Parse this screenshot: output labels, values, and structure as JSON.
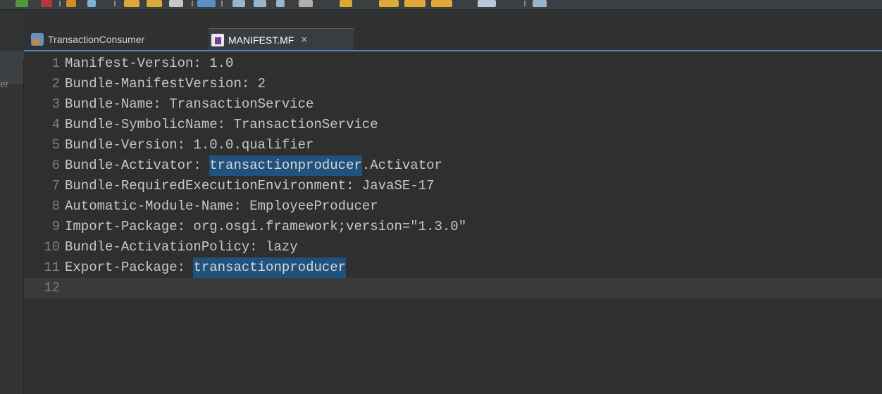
{
  "tabs": [
    {
      "label": "TransactionConsumer",
      "icon": "plugin-project-icon",
      "active": false
    },
    {
      "label": "MANIFEST.MF",
      "icon": "manifest-file-icon",
      "active": true,
      "close": "×"
    }
  ],
  "left_panel": {
    "fragment": "er"
  },
  "editor": {
    "highlight_term": "transactionproducer",
    "lines": [
      {
        "num": "1",
        "pre": "Manifest-Version: 1.0",
        "hl": "",
        "post": ""
      },
      {
        "num": "2",
        "pre": "Bundle-ManifestVersion: 2",
        "hl": "",
        "post": ""
      },
      {
        "num": "3",
        "pre": "Bundle-Name: TransactionService",
        "hl": "",
        "post": ""
      },
      {
        "num": "4",
        "pre": "Bundle-SymbolicName: TransactionService",
        "hl": "",
        "post": ""
      },
      {
        "num": "5",
        "pre": "Bundle-Version: 1.0.0.qualifier",
        "hl": "",
        "post": ""
      },
      {
        "num": "6",
        "pre": "Bundle-Activator: ",
        "hl": "transactionproducer",
        "post": ".Activator"
      },
      {
        "num": "7",
        "pre": "Bundle-RequiredExecutionEnvironment: JavaSE-17",
        "hl": "",
        "post": ""
      },
      {
        "num": "8",
        "pre": "Automatic-Module-Name: EmployeeProducer",
        "hl": "",
        "post": ""
      },
      {
        "num": "9",
        "pre": "Import-Package: org.osgi.framework;version=\"1.3.0\"",
        "hl": "",
        "post": ""
      },
      {
        "num": "10",
        "pre": "Bundle-ActivationPolicy: lazy",
        "hl": "",
        "post": ""
      },
      {
        "num": "11",
        "pre": "Export-Package: ",
        "hl": "transactionproducer",
        "post": ""
      },
      {
        "num": "12",
        "pre": "",
        "hl": "",
        "post": ""
      }
    ]
  },
  "colors": {
    "editor_bg": "#2f2f2f",
    "current_line": "#3a3a3a",
    "selection_highlight": "#21517d",
    "text": "#c8c8c8",
    "line_number": "#7e7e7e",
    "tab_active_accent": "#4a88c7"
  }
}
